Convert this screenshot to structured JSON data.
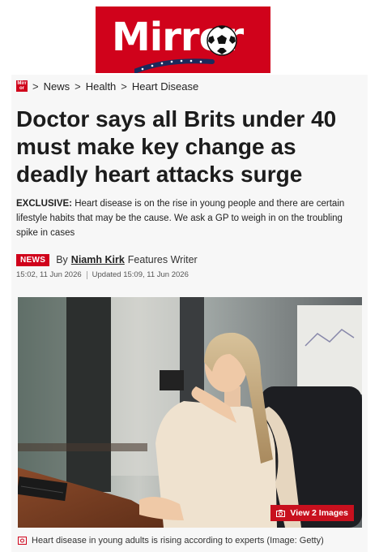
{
  "brand": {
    "logo_text": "Mirror",
    "small_logo_text": "Mirr or",
    "color": "#d0021b"
  },
  "breadcrumb": {
    "items": [
      "News",
      "Health",
      "Heart Disease"
    ],
    "separator": ">"
  },
  "article": {
    "headline": "Doctor says all Brits under 40 must make key change as deadly heart attacks surge",
    "standfirst_label": "EXCLUSIVE:",
    "standfirst_text": " Heart disease is on the rise in young people and there are certain lifestyle habits that may be the cause. We ask a GP to weigh in on the troubling spike in cases",
    "category_badge": "NEWS",
    "byline_prefix": "By",
    "author": "Niamh Kirk",
    "author_role": "Features Writer",
    "published": "15:02, 11 Jun 2026",
    "updated": "Updated 15:09, 11 Jun 2026"
  },
  "image": {
    "view_button": "View 2 Images",
    "caption": "Heart disease in young adults is rising according to experts (Image: Getty)",
    "icons": [
      "camera-icon"
    ]
  }
}
